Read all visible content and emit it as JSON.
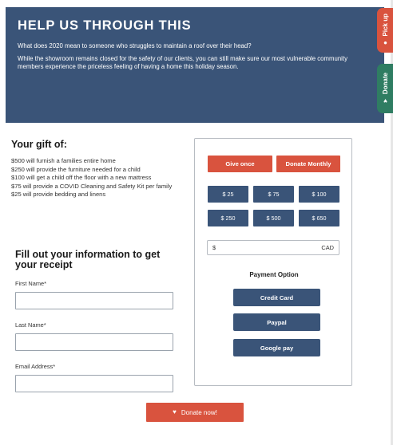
{
  "hero": {
    "title": "HELP US THROUGH THIS",
    "question": "What does 2020 mean to someone who struggles to maintain a roof over their head?",
    "description": "While the showroom remains closed for the safety of our clients, you can still make sure our most vulnerable community members experience the priceless feeling of having a home this holiday season."
  },
  "side_tabs": {
    "pickup": {
      "label": "Pick up",
      "icon": "truck-icon"
    },
    "donate": {
      "label": "Donate",
      "icon": "heart-icon"
    }
  },
  "gift": {
    "heading": "Your gift of:",
    "items": [
      "$500 will furnish a families entire home",
      "$250 will provide the furniture needed for a child",
      "$100 will get a child off the floor with a new mattress",
      "$75 will provide a COVID Cleaning and Safety Kit per family",
      "$25 will provide bedding and linens"
    ]
  },
  "form": {
    "heading": "Fill out your information to get your receipt",
    "first_name_label": "First Name*",
    "last_name_label": "Last Name*",
    "email_label": "Email Address*"
  },
  "panel": {
    "give_once": "Give once",
    "donate_monthly": "Donate Monthly",
    "amounts": [
      "$ 25",
      "$ 75",
      "$ 100",
      "$ 250",
      "$ 500",
      "$ 650"
    ],
    "currency_symbol": "$",
    "currency_code": "CAD",
    "payment_title": "Payment Option",
    "payment_options": [
      "Credit Card",
      "Paypal",
      "Google pay"
    ]
  },
  "cta": {
    "label": "Donate now!"
  },
  "colors": {
    "navy": "#3a5478",
    "red": "#d9533e",
    "green": "#2f7d62"
  }
}
